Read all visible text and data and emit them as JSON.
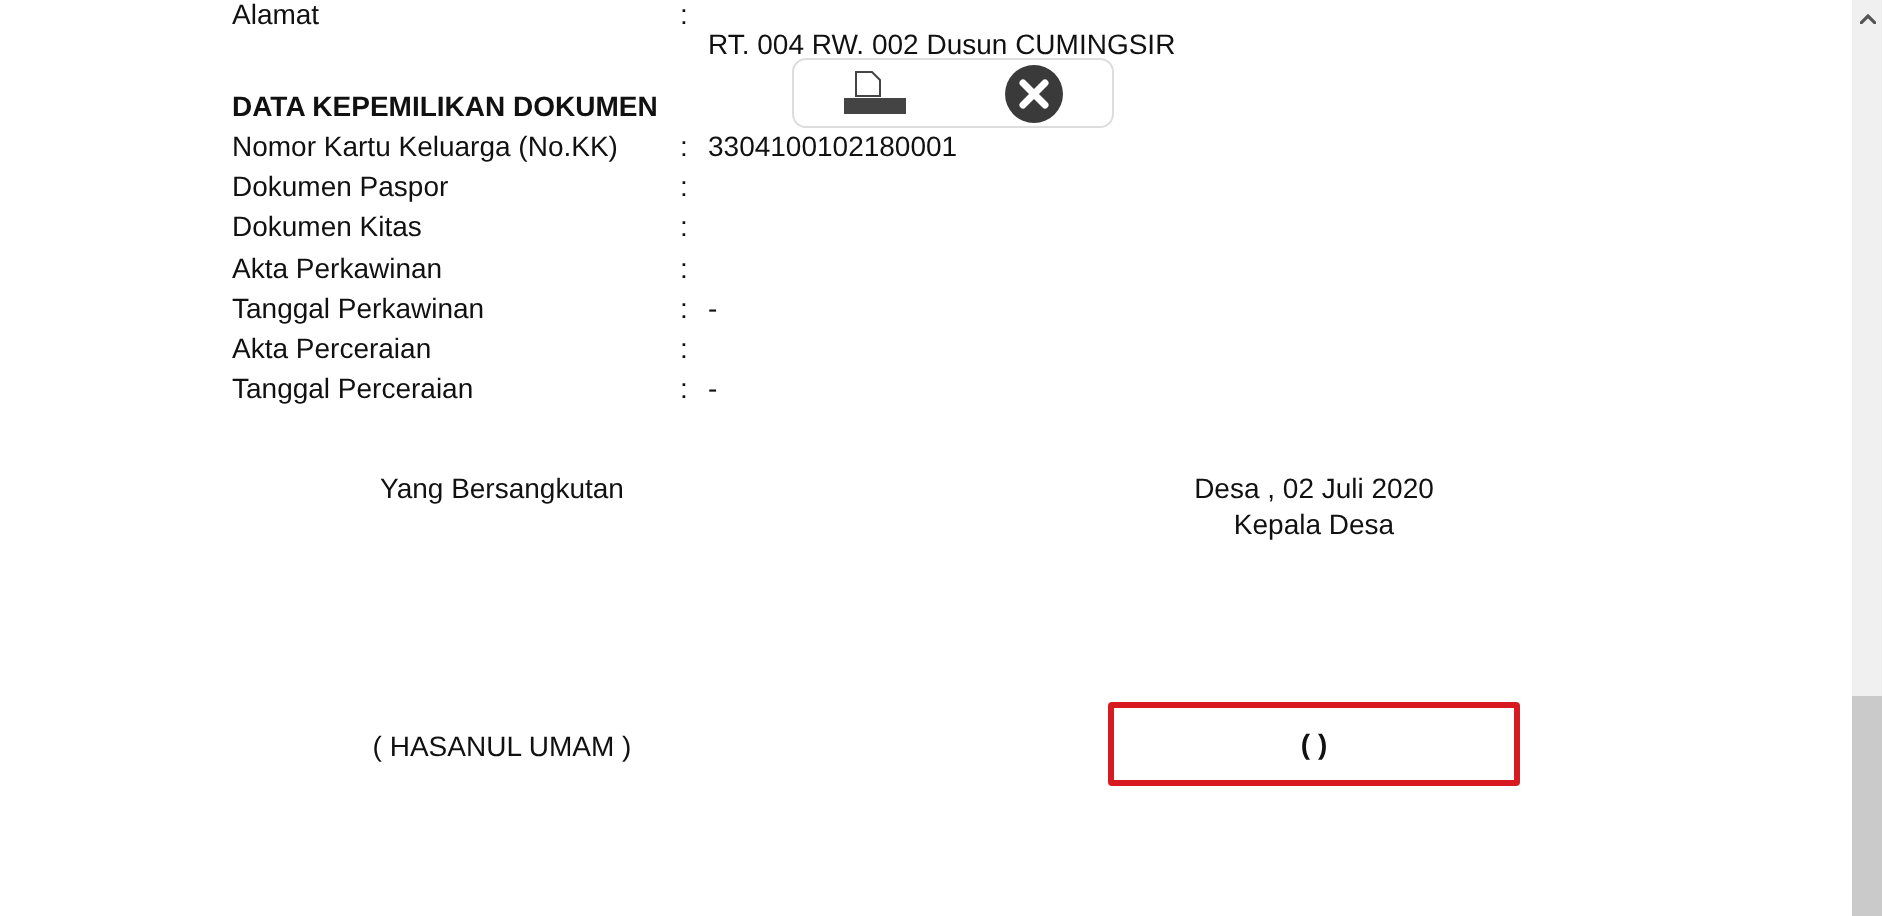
{
  "address": {
    "label": "Alamat",
    "separator": ":",
    "value": "RT. 004 RW. 002 Dusun CUMINGSIR"
  },
  "section": {
    "title": "DATA KEPEMILIKAN DOKUMEN",
    "rows": [
      {
        "label": "Nomor Kartu Keluarga (No.KK)",
        "separator": ":",
        "value": "3304100102180001"
      },
      {
        "label": "Dokumen Paspor",
        "separator": ":"
      },
      {
        "label": "Dokumen Kitas",
        "separator": ":"
      },
      {
        "label": "Akta Perkawinan",
        "separator": ":"
      },
      {
        "label": "Tanggal Perkawinan",
        "separator": ":",
        "value": "-"
      },
      {
        "label": "Akta Perceraian",
        "separator": ":"
      },
      {
        "label": "Tanggal Perceraian",
        "separator": ":",
        "value": "-"
      }
    ]
  },
  "signature": {
    "left_title": "Yang Bersangkutan",
    "right_place_date": "Desa , 02 Juli 2020",
    "right_title": "Kepala Desa",
    "left_name": "( HASANUL UMAM )",
    "right_name": "( )"
  }
}
